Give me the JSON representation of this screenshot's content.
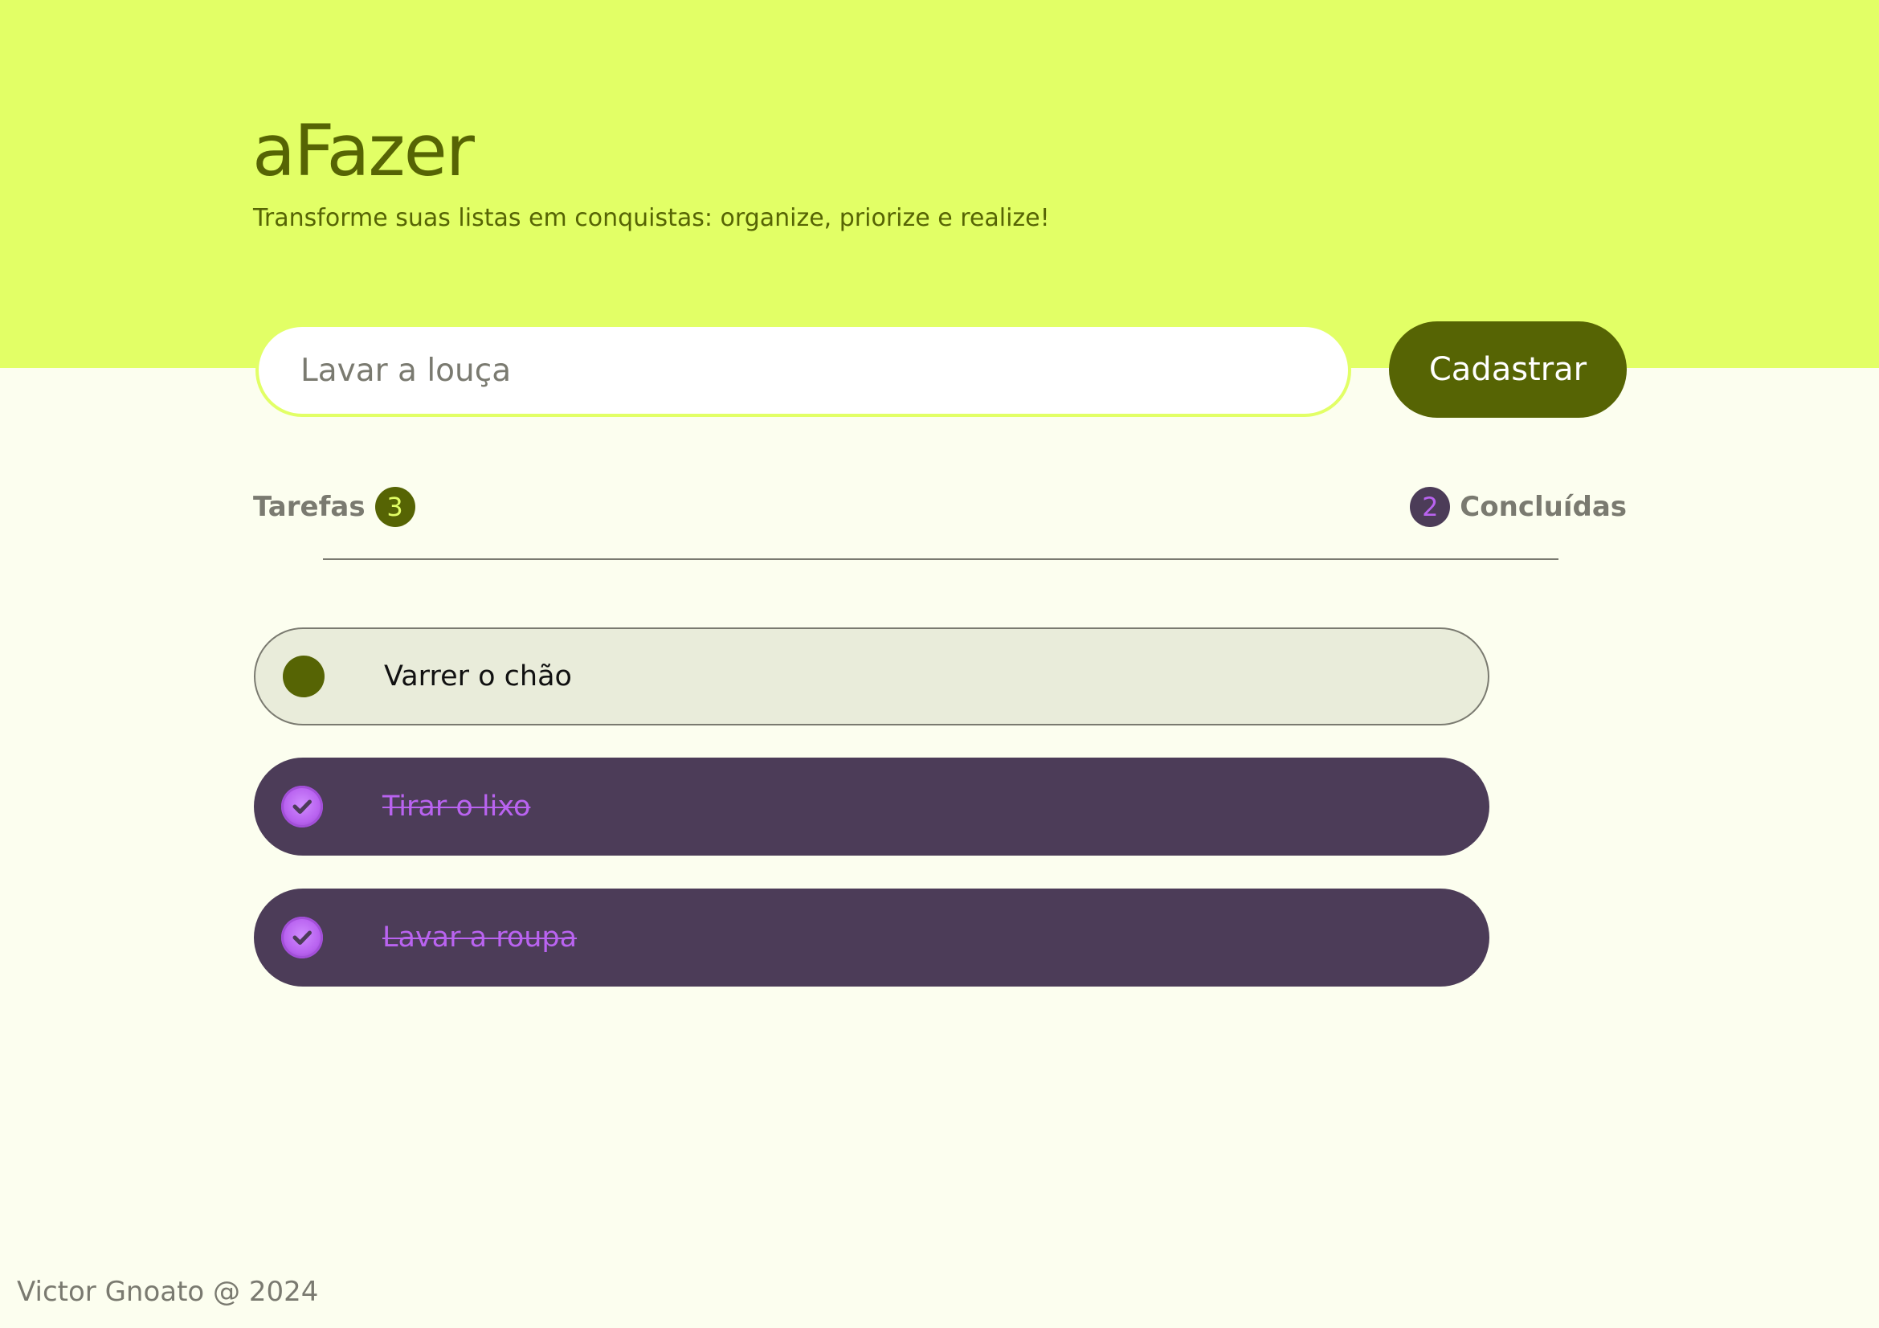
{
  "header": {
    "title": "aFazer",
    "subtitle": "Transforme suas listas em conquistas: organize, priorize e realize!"
  },
  "form": {
    "placeholder": "Lavar a louça",
    "submit_label": "Cadastrar"
  },
  "stats": {
    "tasks_label": "Tarefas",
    "tasks_count": "3",
    "done_count": "2",
    "done_label": "Concluídas"
  },
  "tasks": [
    {
      "label": "Varrer o chão",
      "done": false
    },
    {
      "label": "Tirar o lixo",
      "done": true
    },
    {
      "label": "Lavar a roupa",
      "done": true
    }
  ],
  "icons": {
    "pending": "circle-icon",
    "done": "check-circle-icon"
  },
  "colors": {
    "header_bg": "#e2ff66",
    "page_bg": "#fcfeef",
    "primary": "#566404",
    "done_bg": "#4c3c58",
    "done_accent": "#b963f0",
    "muted_text": "#7a7a70"
  },
  "footer": {
    "text": "Victor Gnoato @ 2024"
  }
}
